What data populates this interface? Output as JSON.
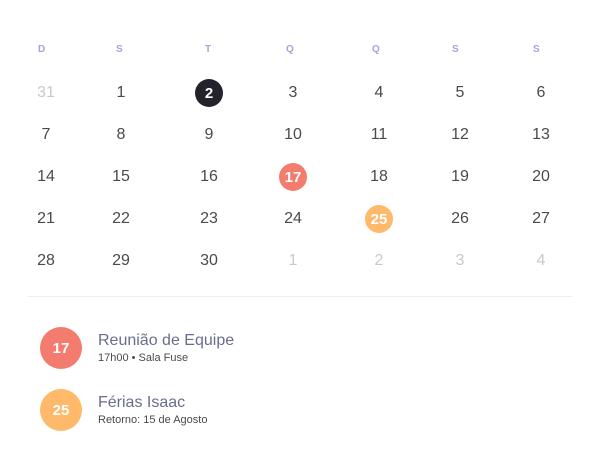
{
  "colors": {
    "weekday": "#a7a2dc",
    "today": "#24232b",
    "event_red": "#f47c6e",
    "event_orange": "#ffb96b",
    "muted": "#c9c9c9"
  },
  "weekdays": [
    "D",
    "S",
    "T",
    "Q",
    "Q",
    "S",
    "S"
  ],
  "weeks": [
    [
      {
        "label": "31",
        "muted": true
      },
      {
        "label": "1"
      },
      {
        "label": "2",
        "state": "today"
      },
      {
        "label": "3"
      },
      {
        "label": "4"
      },
      {
        "label": "5"
      },
      {
        "label": "6"
      }
    ],
    [
      {
        "label": "7"
      },
      {
        "label": "8"
      },
      {
        "label": "9"
      },
      {
        "label": "10"
      },
      {
        "label": "11"
      },
      {
        "label": "12"
      },
      {
        "label": "13"
      }
    ],
    [
      {
        "label": "14"
      },
      {
        "label": "15"
      },
      {
        "label": "16"
      },
      {
        "label": "17",
        "state": "event-red"
      },
      {
        "label": "18"
      },
      {
        "label": "19"
      },
      {
        "label": "20"
      }
    ],
    [
      {
        "label": "21"
      },
      {
        "label": "22"
      },
      {
        "label": "23"
      },
      {
        "label": "24"
      },
      {
        "label": "25",
        "state": "event-orange"
      },
      {
        "label": "26"
      },
      {
        "label": "27"
      }
    ],
    [
      {
        "label": "28"
      },
      {
        "label": "29"
      },
      {
        "label": "30"
      },
      {
        "label": "1",
        "muted": true
      },
      {
        "label": "2",
        "muted": true
      },
      {
        "label": "3",
        "muted": true
      },
      {
        "label": "4",
        "muted": true
      }
    ]
  ],
  "events": [
    {
      "day": "17",
      "title": "Reunião de Equipe",
      "detail": "17h00 • Sala Fuse",
      "color": "#f47c6e"
    },
    {
      "day": "25",
      "title": "Férias Isaac",
      "detail": "Retorno: 15 de Agosto",
      "color": "#ffb96b"
    }
  ]
}
